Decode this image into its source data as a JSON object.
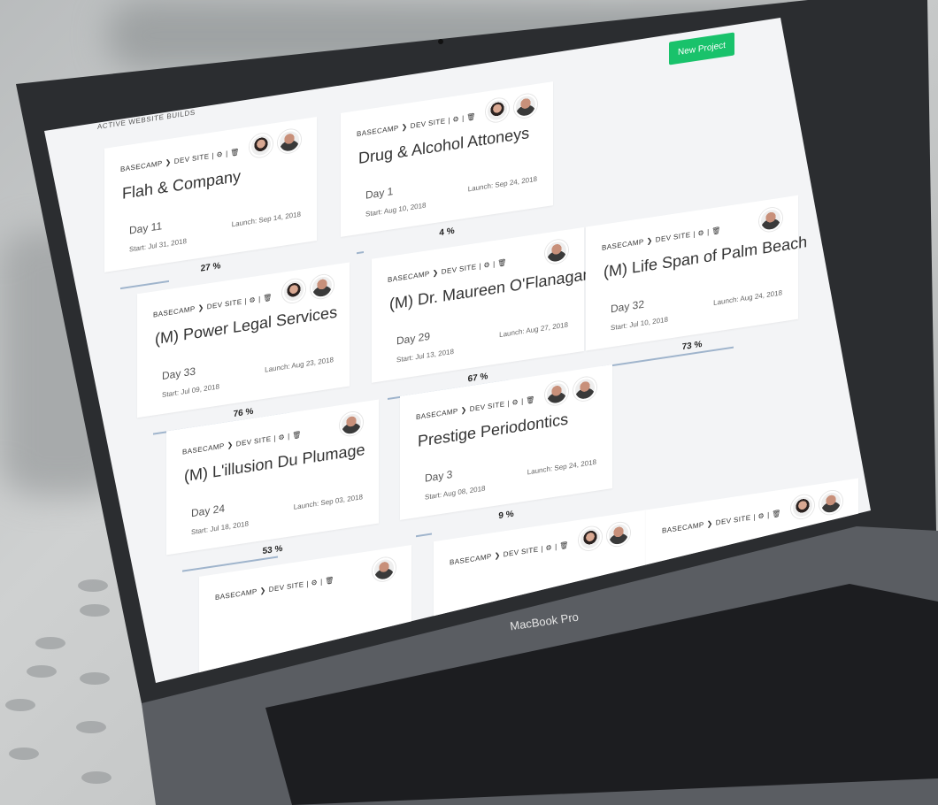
{
  "app": {
    "new_project_label": "New Project",
    "section_title": "ACTIVE WEBSITE BUILDS",
    "device_brand": "MacBook Pro"
  },
  "colors": {
    "accent": "#19c26b",
    "progress": "#9fb4cc"
  },
  "cards": [
    {
      "crumb_a": "BASECAMP",
      "crumb_b": "DEV SITE",
      "name": "Flah & Company",
      "day": "Day 11",
      "start": "Start: Jul 31, 2018",
      "launch": "Launch: Sep 14, 2018",
      "progress": "27 %",
      "progress_value": 0.27
    },
    {
      "crumb_a": "BASECAMP",
      "crumb_b": "DEV SITE",
      "name": "Drug & Alcohol Attoneys",
      "day": "Day 1",
      "start": "Start: Aug 10, 2018",
      "launch": "Launch: Sep 24, 2018",
      "progress": "4 %",
      "progress_value": 0.04
    },
    {
      "crumb_a": "BASECAMP",
      "crumb_b": "DEV SITE",
      "name": "(M) Power Legal Services",
      "day": "Day 33",
      "start": "Start: Jul 09, 2018",
      "launch": "Launch: Aug 23, 2018",
      "progress": "76 %",
      "progress_value": 0.76
    },
    {
      "crumb_a": "BASECAMP",
      "crumb_b": "DEV SITE",
      "name": "(M) Dr. Maureen O'Flanagan",
      "day": "Day 29",
      "start": "Start: Jul 13, 2018",
      "launch": "Launch: Aug 27, 2018",
      "progress": "67 %",
      "progress_value": 0.67
    },
    {
      "crumb_a": "BASECAMP",
      "crumb_b": "DEV SITE",
      "name": "(M) Life Span of Palm Beach",
      "day": "Day 32",
      "start": "Start: Jul 10, 2018",
      "launch": "Launch: Aug 24, 2018",
      "progress": "73 %",
      "progress_value": 0.73
    },
    {
      "crumb_a": "BASECAMP",
      "crumb_b": "DEV SITE",
      "name": "(M) L'illusion Du Plumage",
      "day": "Day 24",
      "start": "Start: Jul 18, 2018",
      "launch": "Launch: Sep 03, 2018",
      "progress": "53 %",
      "progress_value": 0.53
    },
    {
      "crumb_a": "BASECAMP",
      "crumb_b": "DEV SITE",
      "name": "Prestige Periodontics",
      "day": "Day 3",
      "start": "Start: Aug 08, 2018",
      "launch": "Launch: Sep 24, 2018",
      "progress": "9 %",
      "progress_value": 0.09
    },
    {
      "crumb_a": "BASECAMP",
      "crumb_b": "DEV SITE"
    },
    {
      "crumb_a": "BASECAMP",
      "crumb_b": "DEV SITE"
    },
    {
      "crumb_a": "BASECAMP",
      "crumb_b": "DEV SITE"
    }
  ]
}
